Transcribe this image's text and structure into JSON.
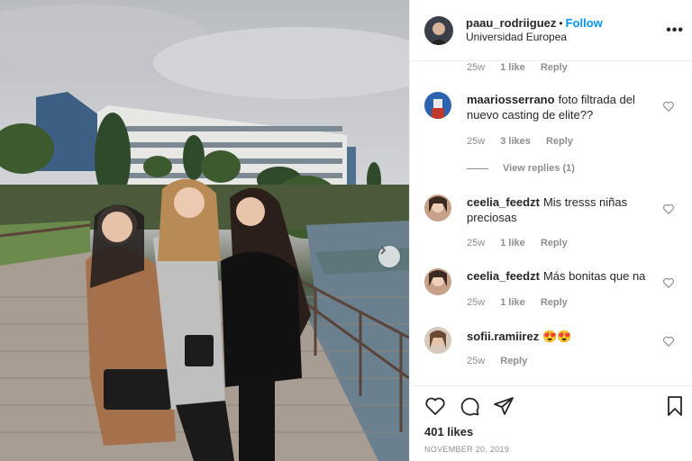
{
  "post": {
    "username": "paau_rodriiguez",
    "separator": "•",
    "follow_label": "Follow",
    "location": "Universidad Europea",
    "more_label": "•••"
  },
  "comments": {
    "top_meta": {
      "time": "25w",
      "likes": "1 like",
      "reply": "Reply"
    },
    "items": [
      {
        "username": "maariosserrano",
        "text": "foto filtrada del nuevo casting de elite??",
        "time": "25w",
        "likes": "3 likes",
        "reply": "Reply",
        "view_replies": "View replies (1)"
      },
      {
        "username": "ceelia_feedzt",
        "text": "Mis tresss niñas preciosas",
        "time": "25w",
        "likes": "1 like",
        "reply": "Reply"
      },
      {
        "username": "ceelia_feedzt",
        "text": "Más bonitas que na",
        "time": "25w",
        "likes": "1 like",
        "reply": "Reply"
      },
      {
        "username": "sofii.ramiirez",
        "text": "😍😍",
        "time": "25w",
        "reply": "Reply"
      }
    ]
  },
  "footer": {
    "likes": "401 likes",
    "date": "NOVEMBER 20, 2019"
  },
  "icons": {
    "like": "heart-icon",
    "comment": "comment-icon",
    "share": "paper-plane-icon",
    "save": "bookmark-icon",
    "next": "chevron-right-icon"
  },
  "colors": {
    "follow": "#0095f6",
    "muted": "#8e8e8e",
    "text": "#262626"
  }
}
